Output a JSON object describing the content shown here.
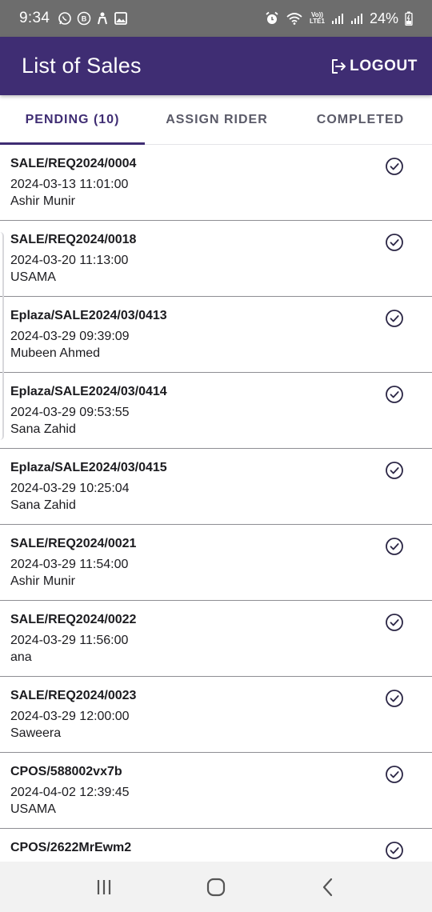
{
  "status_bar": {
    "time": "9:34",
    "battery": "24%",
    "volte_top": "Vo))",
    "volte_bottom": "LTE1",
    "icons": [
      "whatsapp-icon",
      "b-app-icon",
      "person-icon",
      "image-icon",
      "alarm-icon",
      "wifi-icon",
      "volte-icon",
      "signal-icon",
      "signal-icon",
      "battery-charging-icon"
    ]
  },
  "app_bar": {
    "title": "List of Sales",
    "logout_label": "LOGOUT",
    "background": "#3f2d73"
  },
  "tabs": [
    {
      "label": "PENDING (10)",
      "active": true
    },
    {
      "label": "ASSIGN RIDER",
      "active": false
    },
    {
      "label": "COMPLETED",
      "active": false
    }
  ],
  "sales": [
    {
      "id": "SALE/REQ2024/0004",
      "datetime": "2024-03-13 11:01:00",
      "customer": "Ashir Munir"
    },
    {
      "id": "SALE/REQ2024/0018",
      "datetime": "2024-03-20 11:13:00",
      "customer": "USAMA"
    },
    {
      "id": "Eplaza/SALE2024/03/0413",
      "datetime": "2024-03-29 09:39:09",
      "customer": "Mubeen Ahmed"
    },
    {
      "id": "Eplaza/SALE2024/03/0414",
      "datetime": "2024-03-29 09:53:55",
      "customer": "Sana Zahid"
    },
    {
      "id": "Eplaza/SALE2024/03/0415",
      "datetime": "2024-03-29 10:25:04",
      "customer": "Sana Zahid"
    },
    {
      "id": "SALE/REQ2024/0021",
      "datetime": "2024-03-29 11:54:00",
      "customer": "Ashir Munir"
    },
    {
      "id": "SALE/REQ2024/0022",
      "datetime": "2024-03-29 11:56:00",
      "customer": "ana"
    },
    {
      "id": "SALE/REQ2024/0023",
      "datetime": "2024-03-29 12:00:00",
      "customer": "Saweera"
    },
    {
      "id": "CPOS/588002vx7b",
      "datetime": "2024-04-02 12:39:45",
      "customer": "USAMA"
    },
    {
      "id": "CPOS/2622MrEwm2",
      "datetime": "",
      "customer": ""
    }
  ],
  "row_action_icon": "check-circle-icon",
  "nav_bar": {
    "buttons": [
      "recent-apps-icon",
      "home-icon",
      "back-icon"
    ]
  }
}
